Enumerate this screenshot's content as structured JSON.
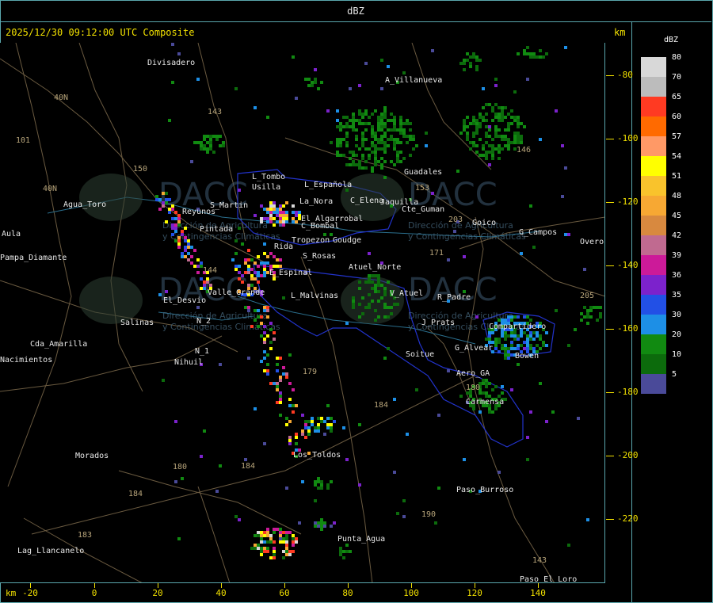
{
  "header": {
    "title": "dBZ"
  },
  "info": {
    "timestamp": "2025/12/30 09:12:00 UTC Composite",
    "km_top": "km",
    "km_bottom": "km"
  },
  "y_axis": {
    "ticks": [
      "-80",
      "-100",
      "-120",
      "-140",
      "-160",
      "-180",
      "-200",
      "-220"
    ]
  },
  "x_axis": {
    "ticks": [
      "-20",
      "0",
      "20",
      "40",
      "60",
      "80",
      "100",
      "120",
      "140"
    ]
  },
  "legend": {
    "title": "dBZ",
    "entries": [
      {
        "label": "80",
        "color": "#d8d8d8"
      },
      {
        "label": "70",
        "color": "#bcbcbc"
      },
      {
        "label": "65",
        "color": "#ff3a22"
      },
      {
        "label": "60",
        "color": "#ff6a00"
      },
      {
        "label": "57",
        "color": "#ff9966"
      },
      {
        "label": "54",
        "color": "#ffff00"
      },
      {
        "label": "51",
        "color": "#f9c32c"
      },
      {
        "label": "48",
        "color": "#f7a833"
      },
      {
        "label": "45",
        "color": "#d8893f"
      },
      {
        "label": "42",
        "color": "#c06a90"
      },
      {
        "label": "39",
        "color": "#cc1a99"
      },
      {
        "label": "36",
        "color": "#7c22cc"
      },
      {
        "label": "35",
        "color": "#2250e6"
      },
      {
        "label": "30",
        "color": "#1d8fe6"
      },
      {
        "label": "20",
        "color": "#118a11"
      },
      {
        "label": "10",
        "color": "#0c6b0c"
      },
      {
        "label": "5",
        "color": "#4a4a99"
      }
    ]
  },
  "places": [
    {
      "name": "Divisadero"
    },
    {
      "name": "A_Villanueva"
    },
    {
      "name": "Guadales"
    },
    {
      "name": "L_Tombo"
    },
    {
      "name": "Usilla"
    },
    {
      "name": "L_Española"
    },
    {
      "name": "La_Nora"
    },
    {
      "name": "C_Elena"
    },
    {
      "name": "Jaquilla"
    },
    {
      "name": "Cte_Guman"
    },
    {
      "name": "Agua_Toro"
    },
    {
      "name": "Reyunos"
    },
    {
      "name": "S_Martin"
    },
    {
      "name": "El_Algarrobal"
    },
    {
      "name": "C_Bombal"
    },
    {
      "name": "Goico"
    },
    {
      "name": "G_Campos"
    },
    {
      "name": "Overo"
    },
    {
      "name": "Aula"
    },
    {
      "name": "Pampa_Diamante"
    },
    {
      "name": "Pintada"
    },
    {
      "name": "Tropezon"
    },
    {
      "name": "Goudge"
    },
    {
      "name": "Rida"
    },
    {
      "name": "S_Rosas"
    },
    {
      "name": "Atuel_Norte"
    },
    {
      "name": "E_Espinal"
    },
    {
      "name": "Valle_Grande"
    },
    {
      "name": "L_Malvinas"
    },
    {
      "name": "V_Atuel"
    },
    {
      "name": "R_Padre"
    },
    {
      "name": "El_Desvio"
    },
    {
      "name": "Salinas"
    },
    {
      "name": "N_2"
    },
    {
      "name": "J_Prats"
    },
    {
      "name": "Compartidero"
    },
    {
      "name": "Cda_Amarilla"
    },
    {
      "name": "N_1"
    },
    {
      "name": "Nihuil"
    },
    {
      "name": "Soitue"
    },
    {
      "name": "G_Alvear"
    },
    {
      "name": "Bowen"
    },
    {
      "name": "Aero_GA"
    },
    {
      "name": "Carmensa"
    },
    {
      "name": "Morados"
    },
    {
      "name": "Los_Toldos"
    },
    {
      "name": "Paso_Burroso"
    },
    {
      "name": "Punta_Agua"
    },
    {
      "name": "Lag_Llancanelo"
    },
    {
      "name": "Paso_El_Loro"
    },
    {
      "name": "Nacimientos"
    }
  ],
  "route_numbers": [
    "143",
    "146",
    "40N",
    "101",
    "150",
    "40N",
    "153",
    "203",
    "171",
    "144",
    "179",
    "184",
    "180",
    "184",
    "190",
    "183",
    "143",
    "205",
    "180",
    "184"
  ],
  "watermark": {
    "brand": "DACC",
    "line1": "Dirección de Agricultura",
    "line2": "y Contingencias Climáticas"
  }
}
